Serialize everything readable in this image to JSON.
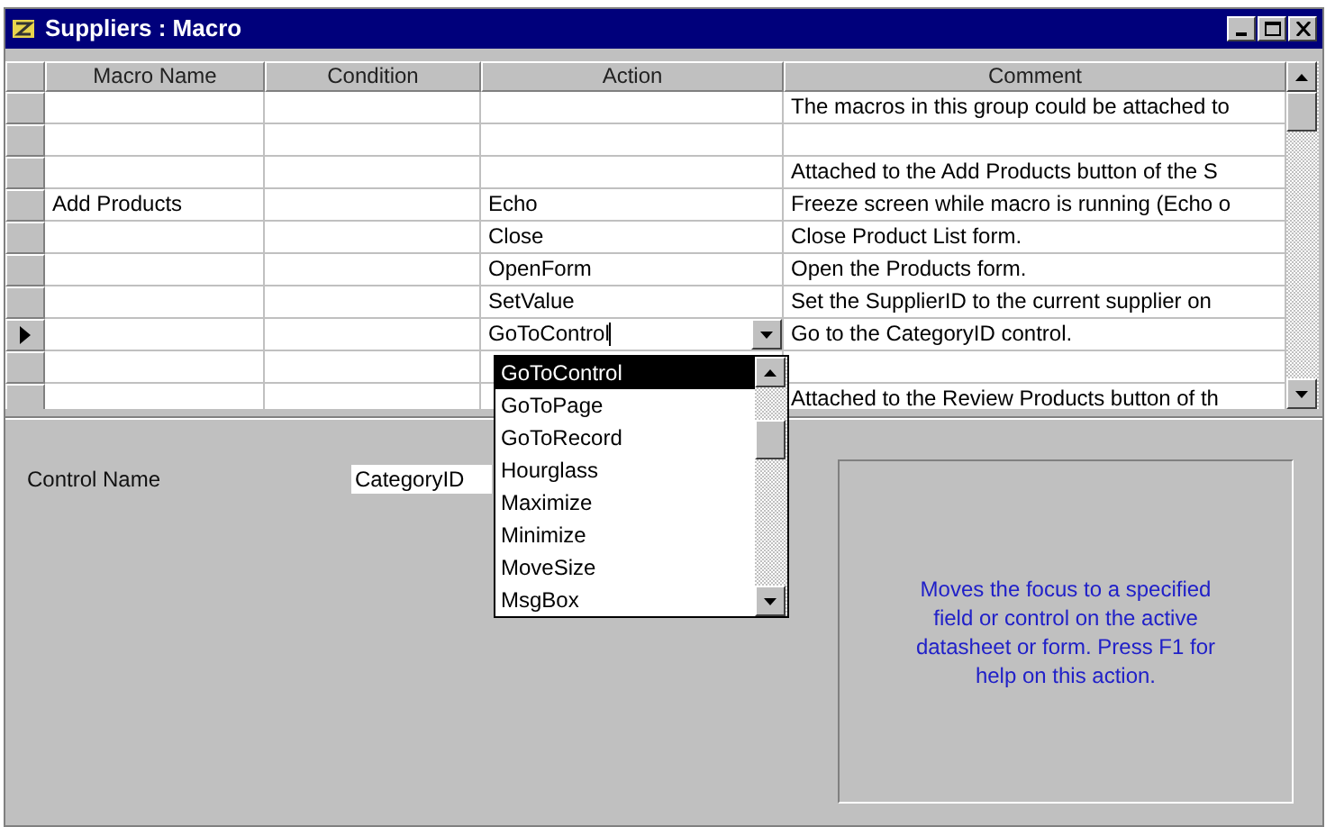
{
  "window": {
    "title": "Suppliers : Macro"
  },
  "columns": [
    "Macro Name",
    "Condition",
    "Action",
    "Comment"
  ],
  "rows": [
    {
      "current": false,
      "macro_name": "",
      "condition": "",
      "action": "",
      "comment": "The macros in this group could be attached to"
    },
    {
      "current": false,
      "macro_name": "",
      "condition": "",
      "action": "",
      "comment": ""
    },
    {
      "current": false,
      "macro_name": "",
      "condition": "",
      "action": "",
      "comment": "Attached to the Add Products button of the S"
    },
    {
      "current": false,
      "macro_name": "Add Products",
      "condition": "",
      "action": "Echo",
      "comment": "Freeze screen while macro is running (Echo o"
    },
    {
      "current": false,
      "macro_name": "",
      "condition": "",
      "action": "Close",
      "comment": "Close Product List form."
    },
    {
      "current": false,
      "macro_name": "",
      "condition": "",
      "action": "OpenForm",
      "comment": "Open the Products form."
    },
    {
      "current": false,
      "macro_name": "",
      "condition": "",
      "action": "SetValue",
      "comment": "Set the SupplierID to the current supplier on"
    },
    {
      "current": true,
      "macro_name": "",
      "condition": "",
      "action": "GoToControl",
      "comment": "Go to the CategoryID control."
    },
    {
      "current": false,
      "macro_name": "",
      "condition": "",
      "action": "",
      "comment": ""
    },
    {
      "current": false,
      "macro_name": "",
      "condition": "",
      "action": "",
      "comment": "Attached to the Review Products button of th"
    }
  ],
  "action_dropdown": {
    "open": true,
    "items": [
      {
        "label": "GoToControl",
        "selected": true
      },
      {
        "label": "GoToPage",
        "selected": false
      },
      {
        "label": "GoToRecord",
        "selected": false
      },
      {
        "label": "Hourglass",
        "selected": false
      },
      {
        "label": "Maximize",
        "selected": false
      },
      {
        "label": "Minimize",
        "selected": false
      },
      {
        "label": "MoveSize",
        "selected": false
      },
      {
        "label": "MsgBox",
        "selected": false
      }
    ]
  },
  "arguments": [
    {
      "label": "Control Name",
      "value": "CategoryID"
    }
  ],
  "help_text": "Moves the focus to a specified field or control on the active datasheet or form. Press F1 for help on this action."
}
